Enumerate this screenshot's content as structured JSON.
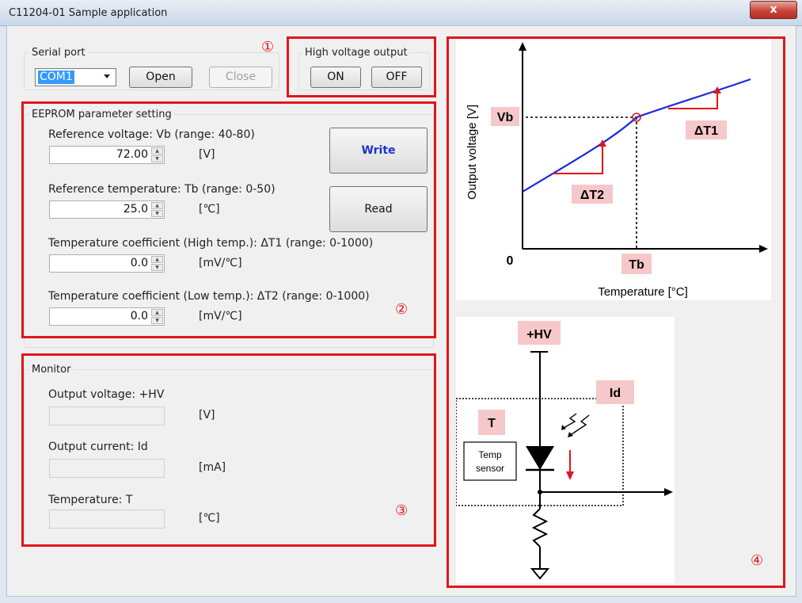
{
  "window": {
    "title": "C11204-01 Sample application",
    "close_glyph": "x"
  },
  "serial_port": {
    "label": "Serial port",
    "port_value": "COM1",
    "open_label": "Open",
    "close_label": "Close"
  },
  "hv_output": {
    "label": "High voltage output",
    "on_label": "ON",
    "off_label": "OFF"
  },
  "eeprom": {
    "label": "EEPROM parameter setting",
    "ref_voltage_label": "Reference voltage: Vb (range: 40-80)",
    "ref_voltage_value": "72.00",
    "ref_voltage_unit": "[V]",
    "ref_temp_label": "Reference temperature: Tb (range: 0-50)",
    "ref_temp_value": "25.0",
    "ref_temp_unit": "[℃]",
    "tc_high_label": "Temperature coefficient (High temp.): ΔT1  (range: 0-1000)",
    "tc_high_value": "0.0",
    "tc_high_unit": "[mV/℃]",
    "tc_low_label": "Temperature coefficient (Low temp.): ΔT2  (range: 0-1000)",
    "tc_low_value": "0.0",
    "tc_low_unit": "[mV/℃]",
    "write_label": "Write",
    "read_label": "Read"
  },
  "monitor": {
    "label": "Monitor",
    "output_voltage_label": "Output voltage: +HV",
    "output_voltage_unit": "[V]",
    "output_current_label": "Output current: Id",
    "output_current_unit": "[mA]",
    "temperature_label": "Temperature: T",
    "temperature_unit": "[℃]"
  },
  "annotations": {
    "c1": "①",
    "c2": "②",
    "c3": "③",
    "c4": "④"
  },
  "graph": {
    "ylabel": "Output voltage [V]",
    "xlabel": "Temperature [°C]",
    "vb": "Vb",
    "tb": "Tb",
    "zero": "0",
    "dt1": "ΔT1",
    "dt2": "ΔT2"
  },
  "circuit": {
    "hv": "+HV",
    "id": "Id",
    "t": "T",
    "sensor_line1": "Temp",
    "sensor_line2": "sensor"
  },
  "colors": {
    "annotation_red": "#e0161b",
    "graph_line": "#1a2ae0",
    "label_pink": "#f6c8c9",
    "write_text": "#1a33cc"
  }
}
